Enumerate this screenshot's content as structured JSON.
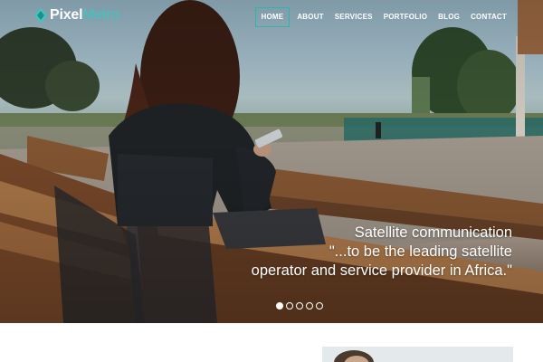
{
  "brand": {
    "name_part1": "Pixel",
    "name_part2": "Metro"
  },
  "nav": {
    "items": [
      {
        "label": "HOME",
        "active": true
      },
      {
        "label": "ABOUT",
        "active": false
      },
      {
        "label": "SERVICES",
        "active": false
      },
      {
        "label": "PORTFOLIO",
        "active": false
      },
      {
        "label": "BLOG",
        "active": false
      },
      {
        "label": "CONTACT",
        "active": false
      }
    ]
  },
  "slider": {
    "caption": {
      "title": "Satellite communication",
      "quote_line1": "\"...to be the leading satellite",
      "quote_line2": "operator and service provider in Africa.\""
    },
    "dots": [
      true,
      false,
      false,
      false,
      false
    ]
  },
  "colors": {
    "accent": "#3cc7c0",
    "nav_active_border": "#2fb5b0",
    "text_light": "#ffffff"
  },
  "icons": {
    "logo": "diamond-logo-icon"
  }
}
